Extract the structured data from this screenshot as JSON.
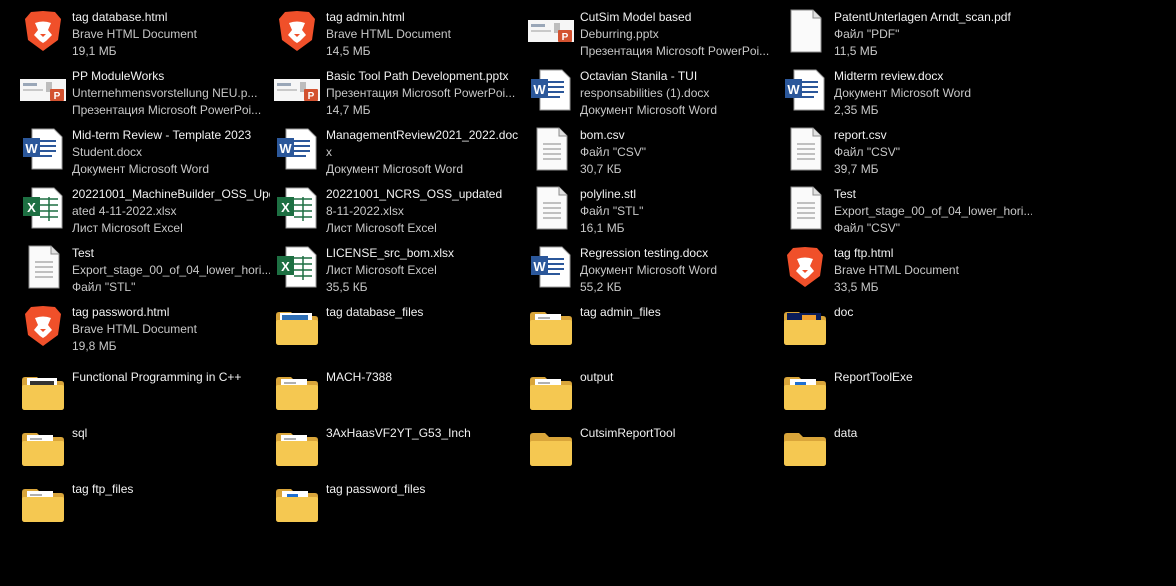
{
  "items": [
    {
      "icon": "brave",
      "lines": [
        "tag database.html",
        "Brave HTML Document",
        "19,1 МБ"
      ]
    },
    {
      "icon": "brave",
      "lines": [
        "tag admin.html",
        "Brave HTML Document",
        "14,5 МБ"
      ]
    },
    {
      "icon": "pptx",
      "lines": [
        "CutSim Model based",
        "Deburring.pptx",
        "Презентация Microsoft PowerPoi..."
      ]
    },
    {
      "icon": "pdf",
      "lines": [
        "PatentUnterlagen Arndt_scan.pdf",
        "Файл \"PDF\"",
        "11,5 МБ"
      ]
    },
    {
      "icon": "pptx",
      "lines": [
        "PP ModuleWorks",
        "Unternehmensvorstellung NEU.p...",
        "Презентация Microsoft PowerPoi..."
      ]
    },
    {
      "icon": "pptx",
      "lines": [
        "Basic Tool Path Development.pptx",
        "Презентация Microsoft PowerPoi...",
        "14,7 МБ"
      ]
    },
    {
      "icon": "word",
      "lines": [
        "Octavian Stanila - TUI",
        "responsabilities (1).docx",
        "Документ Microsoft Word"
      ]
    },
    {
      "icon": "word",
      "lines": [
        "Midterm review.docx",
        "Документ Microsoft Word",
        "2,35 МБ"
      ]
    },
    {
      "icon": "word",
      "lines": [
        "Mid-term Review - Template 2023",
        "Student.docx",
        "Документ Microsoft Word"
      ]
    },
    {
      "icon": "word",
      "lines": [
        "ManagementReview2021_2022.doc",
        "x",
        "Документ Microsoft Word"
      ]
    },
    {
      "icon": "file",
      "lines": [
        "bom.csv",
        "Файл \"CSV\"",
        "30,7 КБ"
      ]
    },
    {
      "icon": "file",
      "lines": [
        "report.csv",
        "Файл \"CSV\"",
        "39,7 МБ"
      ]
    },
    {
      "icon": "excel",
      "lines": [
        "20221001_MachineBuilder_OSS_Upd",
        "ated  4-11-2022.xlsx",
        "Лист Microsoft Excel"
      ]
    },
    {
      "icon": "excel",
      "lines": [
        "20221001_NCRS_OSS_updated",
        "8-11-2022.xlsx",
        "Лист Microsoft Excel"
      ]
    },
    {
      "icon": "file",
      "lines": [
        "polyline.stl",
        "Файл \"STL\"",
        "16,1 МБ"
      ]
    },
    {
      "icon": "file",
      "lines": [
        "Test",
        "Export_stage_00_of_04_lower_hori...",
        "Файл \"CSV\""
      ]
    },
    {
      "icon": "file",
      "lines": [
        "Test",
        "Export_stage_00_of_04_lower_hori...",
        "Файл \"STL\""
      ]
    },
    {
      "icon": "excel",
      "lines": [
        "LICENSE_src_bom.xlsx",
        "Лист Microsoft Excel",
        "35,5 КБ"
      ]
    },
    {
      "icon": "word",
      "lines": [
        "Regression testing.docx",
        "Документ Microsoft Word",
        "55,2 КБ"
      ]
    },
    {
      "icon": "brave",
      "lines": [
        "tag ftp.html",
        "Brave HTML Document",
        "33,5 МБ"
      ]
    },
    {
      "icon": "brave",
      "lines": [
        "tag password.html",
        "Brave HTML Document",
        "19,8 МБ"
      ]
    },
    {
      "icon": "folder-assign",
      "lines": [
        "tag database_files"
      ]
    },
    {
      "icon": "folder-doc",
      "lines": [
        "tag admin_files"
      ]
    },
    {
      "icon": "folder-dark",
      "lines": [
        "doc"
      ]
    },
    {
      "icon": "folder-window",
      "lines": [
        "Functional Programming in C++"
      ]
    },
    {
      "icon": "folder-doc",
      "lines": [
        "MACH-7388"
      ]
    },
    {
      "icon": "folder-doc",
      "lines": [
        "output"
      ]
    },
    {
      "icon": "folder-blue",
      "lines": [
        "ReportToolExe"
      ]
    },
    {
      "icon": "folder-doc",
      "lines": [
        "sql"
      ]
    },
    {
      "icon": "folder-doc",
      "lines": [
        "3AxHaasVF2YT_G53_Inch"
      ]
    },
    {
      "icon": "folder",
      "lines": [
        "CutsimReportTool"
      ]
    },
    {
      "icon": "folder",
      "lines": [
        "data"
      ]
    },
    {
      "icon": "folder-doc",
      "lines": [
        "tag ftp_files"
      ]
    },
    {
      "icon": "folder-blue",
      "lines": [
        "tag password_files"
      ]
    }
  ]
}
